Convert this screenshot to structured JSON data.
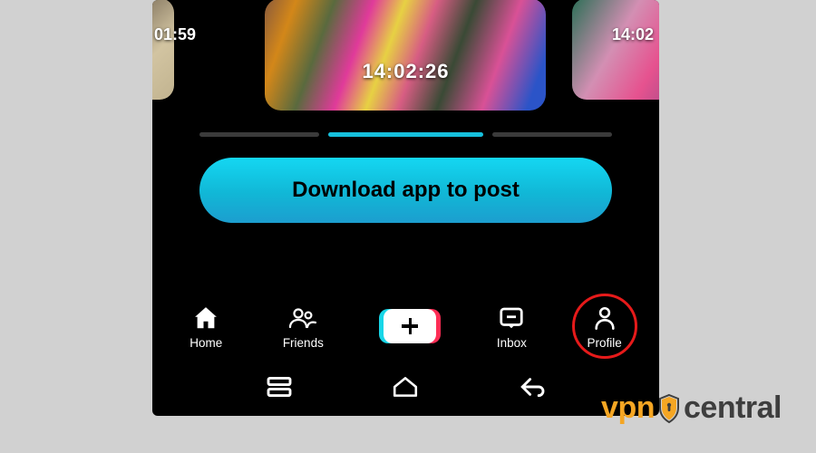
{
  "stories": {
    "left_time": "01:59",
    "center_time": "14:02:26",
    "right_time": "14:02"
  },
  "cta": {
    "label": "Download app to post"
  },
  "tabs": {
    "home": "Home",
    "friends": "Friends",
    "inbox": "Inbox",
    "profile": "Profile"
  },
  "watermark": {
    "part1": "vpn",
    "part2": "central"
  },
  "icons": {
    "home": "home-icon",
    "friends": "friends-icon",
    "create": "create-icon",
    "inbox": "inbox-icon",
    "profile": "profile-icon",
    "shield": "shield-icon",
    "nav_recent": "recent-apps-icon",
    "nav_home": "nav-home-icon",
    "nav_back": "nav-back-icon"
  },
  "colors": {
    "cta_gradient_top": "#14d7f2",
    "cta_gradient_bottom": "#1c9ecf",
    "progress_active": "#16c0dd",
    "highlight_ring": "#e61a1a",
    "watermark_accent": "#f5a623"
  }
}
